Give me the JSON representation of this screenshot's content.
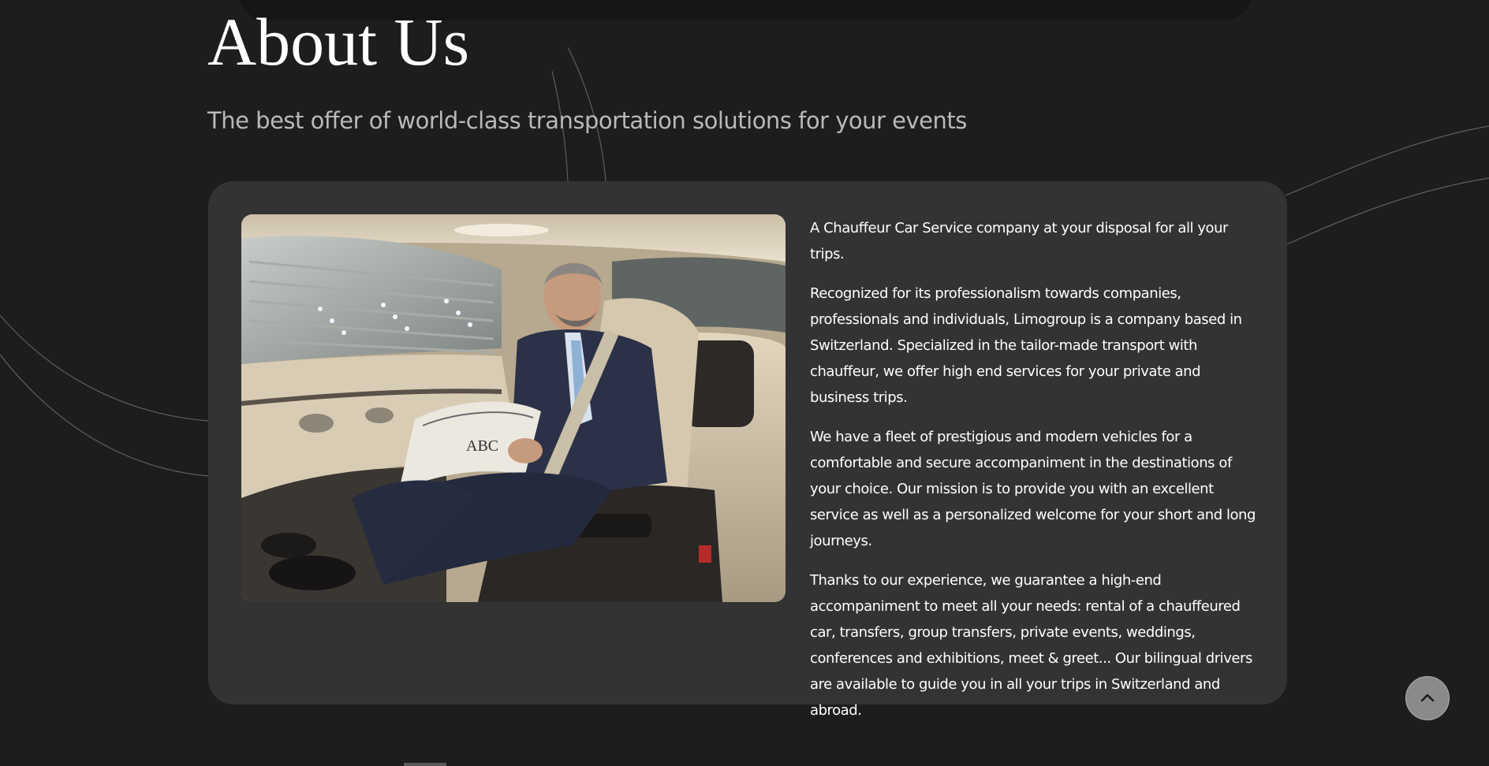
{
  "page": {
    "title": "About Us",
    "subtitle": "The best offer of world-class transportation solutions for your events"
  },
  "about": {
    "image_description_icon": "photo-chauffeur-passenger",
    "paragraphs": [
      "A Chauffeur Car Service company at your disposal for all your trips.",
      "Recognized for its professionalism towards companies, professionals and individuals, Limogroup is a company based in Switzerland. Specialized in the tailor-made transport with chauffeur, we offer high end services for your private and business trips.",
      "We have a fleet of prestigious and modern vehicles for a comfortable and secure accompaniment in the destinations of your choice. Our mission is to provide you with an excellent service as well as a personalized welcome for your short and long journeys.",
      "Thanks to our experience, we guarantee a high-end accompaniment to meet all your needs: rental of a chauffeured car, transfers, group transfers, private events, weddings, conferences and exhibitions, meet & greet... Our bilingual drivers are available to guide you in all your trips in Switzerland and abroad."
    ]
  },
  "scroll_top": {
    "icon": "chevron-up-icon"
  },
  "colors": {
    "background": "#1d1d1d",
    "card": "#333333",
    "title": "#ffffff",
    "subtitle": "#b9b9b9",
    "body_text": "#ffffff",
    "scroll_button": "#8a8a8a"
  }
}
